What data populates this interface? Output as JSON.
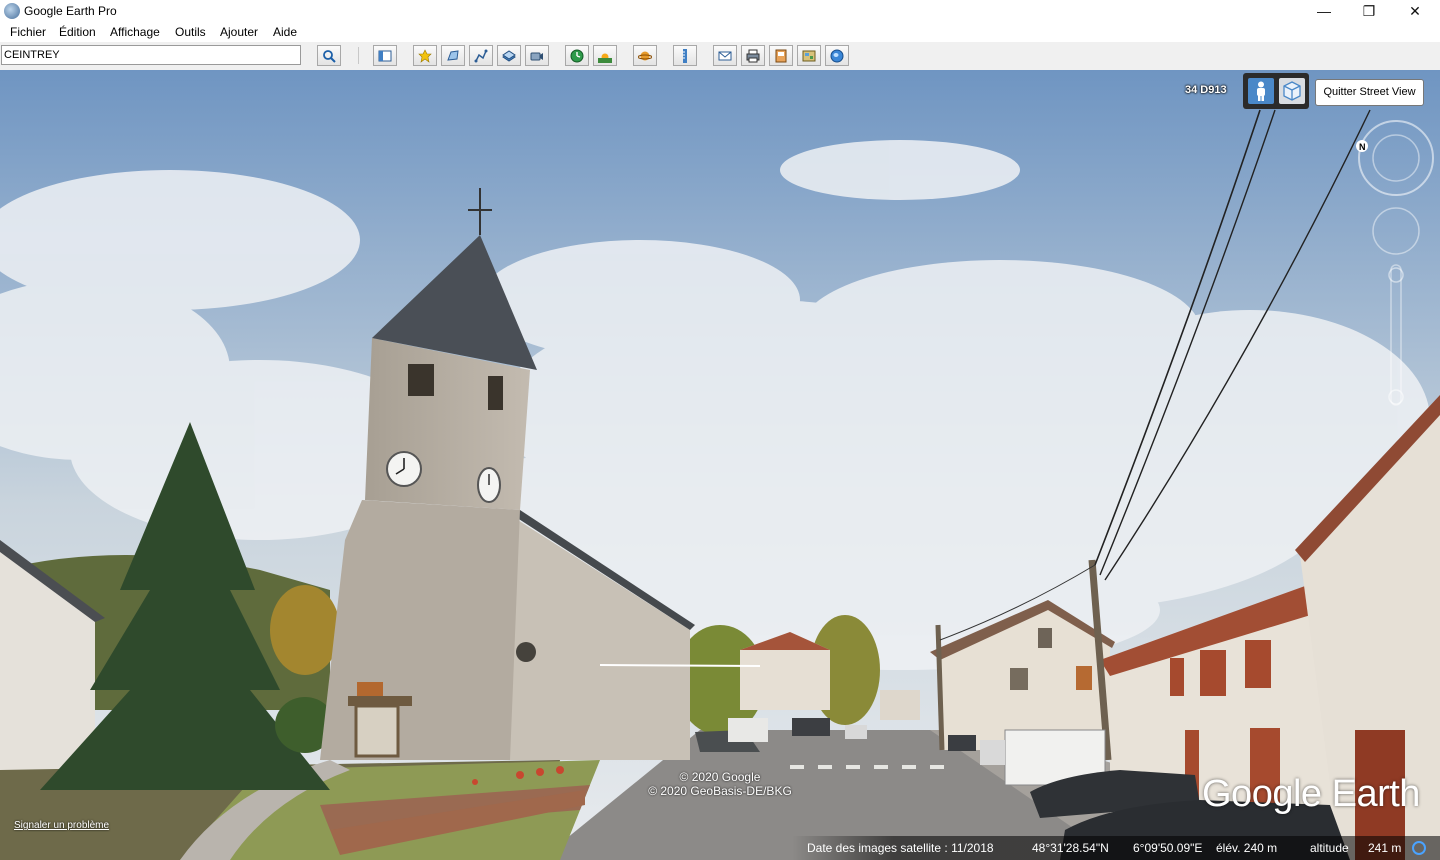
{
  "window": {
    "title": "Google Earth Pro",
    "minimize": "—",
    "maximize": "❐",
    "close": "✕"
  },
  "menu": [
    {
      "label": "Fichier"
    },
    {
      "label": "Édition"
    },
    {
      "label": "Affichage"
    },
    {
      "label": "Outils"
    },
    {
      "label": "Ajouter"
    },
    {
      "label": "Aide"
    }
  ],
  "toolbar": {
    "search_value": "CEINTREY",
    "buttons": [
      "search-icon",
      "sidebar-icon",
      "placemark-icon",
      "polygon-icon",
      "path-icon",
      "image-overlay-icon",
      "tour-icon",
      "historical-imagery-icon",
      "sunlight-icon",
      "planets-icon",
      "ruler-icon",
      "email-icon",
      "print-icon",
      "save-image-icon",
      "map-icon",
      "web-icon"
    ]
  },
  "viewport": {
    "road_label": "34 D913",
    "exit_label": "Quitter Street View",
    "copyright": [
      "© 2020 Google",
      "© 2020 GeoBasis-DE/BKG"
    ],
    "report_link": "Signaler un problème",
    "logo": "Google Earth",
    "status": {
      "imagery_date": "Date des images satellite : 11/2018",
      "lat": "48°31'28.54\"N",
      "lon": "6°09'50.09\"E",
      "elev": "élév.  240 m",
      "altitude_label": "altitude",
      "altitude_value": "241 m"
    }
  },
  "colors": {
    "sky": "#7ea2c9",
    "ui_accent": "#4a88c8",
    "toolbar_bg": "#f0f0f0"
  }
}
